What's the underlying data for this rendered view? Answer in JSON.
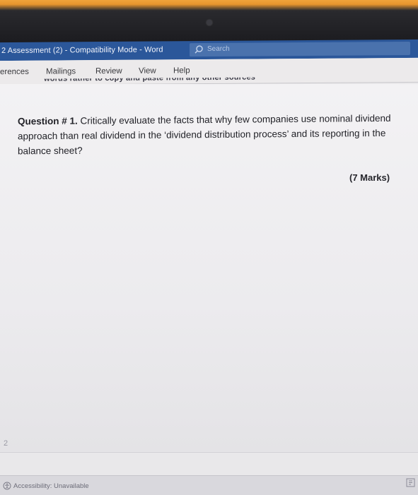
{
  "window": {
    "title": "2 Assessment (2)  -  Compatibility Mode  -  Word",
    "search_label": "Search"
  },
  "ribbon": {
    "tabs": [
      "erences",
      "Mailings",
      "Review",
      "View",
      "Help"
    ],
    "partial_text": "words rather to copy and paste from any other sources"
  },
  "document": {
    "question_label": "Question # 1.",
    "question_text": " Critically evaluate the facts that why few companies use nominal dividend approach than real dividend in the ‘dividend distribution process’ and its reporting in the balance sheet?",
    "marks": "(7 Marks)",
    "page_number": "2"
  },
  "status_bar": {
    "accessibility": "Accessibility: Unavailable"
  },
  "colors": {
    "titlebar": "#2b579a",
    "ribbon": "#eceaeb",
    "page": "#f3f2f4"
  }
}
